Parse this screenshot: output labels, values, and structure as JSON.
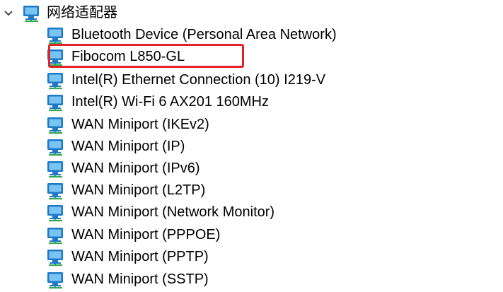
{
  "category": {
    "label": "网络适配器",
    "expanded": true,
    "chevron_icon": "chevron-down-icon",
    "icon": "network-adapter-icon"
  },
  "devices": [
    {
      "label": "Bluetooth Device (Personal Area Network)",
      "icon": "network-adapter-icon"
    },
    {
      "label": "Fibocom L850-GL",
      "icon": "network-adapter-icon",
      "highlighted": true
    },
    {
      "label": "Intel(R) Ethernet Connection (10) I219-V",
      "icon": "network-adapter-icon"
    },
    {
      "label": "Intel(R) Wi-Fi 6 AX201 160MHz",
      "icon": "network-adapter-icon"
    },
    {
      "label": "WAN Miniport (IKEv2)",
      "icon": "network-adapter-icon"
    },
    {
      "label": "WAN Miniport (IP)",
      "icon": "network-adapter-icon"
    },
    {
      "label": "WAN Miniport (IPv6)",
      "icon": "network-adapter-icon"
    },
    {
      "label": "WAN Miniport (L2TP)",
      "icon": "network-adapter-icon"
    },
    {
      "label": "WAN Miniport (Network Monitor)",
      "icon": "network-adapter-icon"
    },
    {
      "label": "WAN Miniport (PPPOE)",
      "icon": "network-adapter-icon"
    },
    {
      "label": "WAN Miniport (PPTP)",
      "icon": "network-adapter-icon"
    },
    {
      "label": "WAN Miniport (SSTP)",
      "icon": "network-adapter-icon"
    }
  ],
  "colors": {
    "highlight_border": "#e3222a",
    "monitor_frame": "#1f79c9",
    "monitor_screen": "#79c5f2",
    "network_cable": "#35a853"
  }
}
